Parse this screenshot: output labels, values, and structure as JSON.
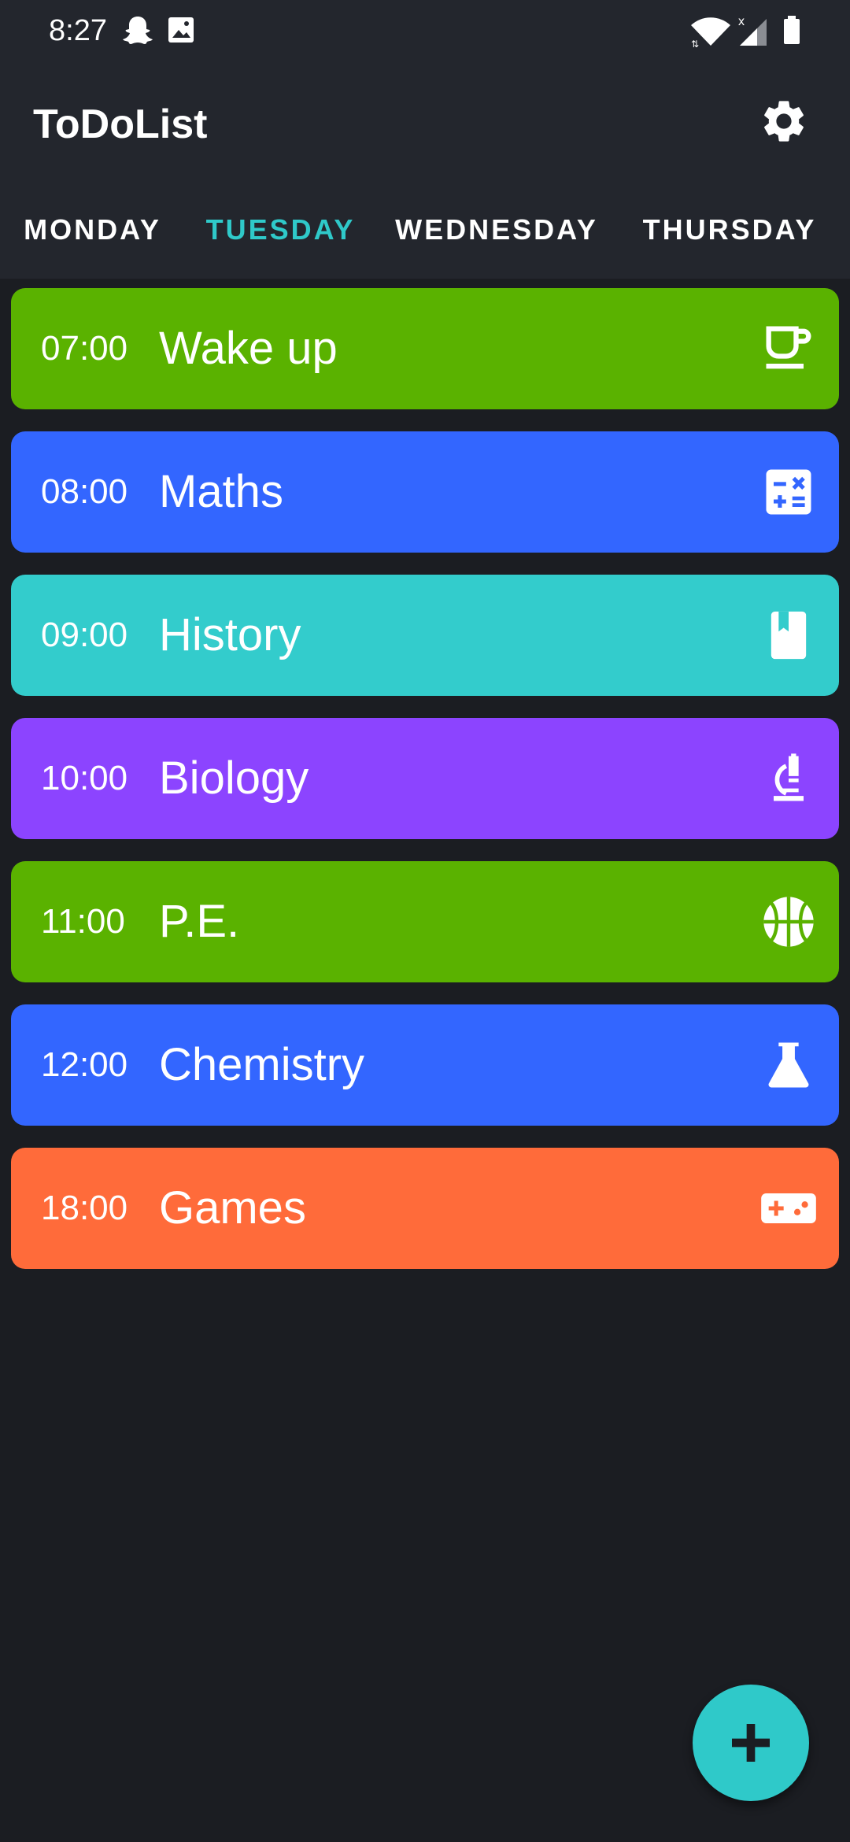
{
  "status_bar": {
    "time": "8:27",
    "icons": [
      "snapchat-icon",
      "image-icon",
      "wifi-icon",
      "signal-icon",
      "battery-icon"
    ]
  },
  "app": {
    "title": "ToDoList",
    "settings_icon": "gear-icon"
  },
  "tabs": [
    {
      "label": "MONDAY",
      "active": false
    },
    {
      "label": "TUESDAY",
      "active": true
    },
    {
      "label": "WEDNESDAY",
      "active": false
    },
    {
      "label": "THURSDAY",
      "active": false
    }
  ],
  "tasks": [
    {
      "time": "07:00",
      "title": "Wake up",
      "icon": "coffee-icon",
      "color": "#5ab200"
    },
    {
      "time": "08:00",
      "title": "Maths",
      "icon": "calculator-icon",
      "color": "#3366ff"
    },
    {
      "time": "09:00",
      "title": "History",
      "icon": "book-icon",
      "color": "#33cccc"
    },
    {
      "time": "10:00",
      "title": "Biology",
      "icon": "microscope-icon",
      "color": "#8c44ff"
    },
    {
      "time": "11:00",
      "title": "P.E.",
      "icon": "basketball-icon",
      "color": "#5ab200"
    },
    {
      "time": "12:00",
      "title": "Chemistry",
      "icon": "flask-icon",
      "color": "#3366ff"
    },
    {
      "time": "18:00",
      "title": "Games",
      "icon": "gamepad-icon",
      "color": "#ff6b3a"
    }
  ],
  "fab": {
    "icon": "plus-icon",
    "color": "#2fc9c9"
  },
  "colors": {
    "background": "#1b1d22",
    "app_bar": "#23262d",
    "accent": "#2fc9c9"
  }
}
